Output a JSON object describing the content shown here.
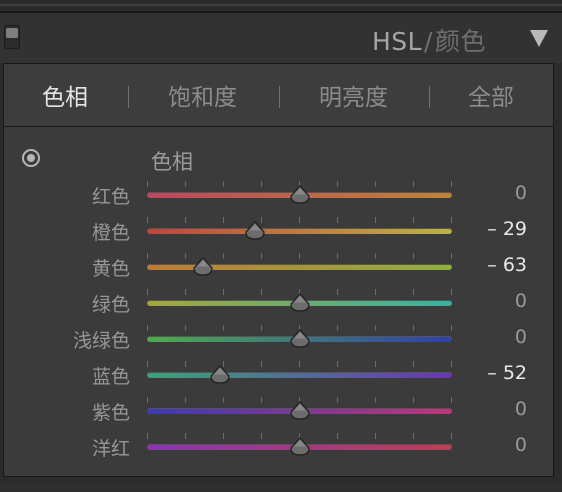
{
  "header": {
    "title_hsl": "HSL",
    "title_sep": "/",
    "title_color": "颜色",
    "collapse_icon": "triangle-down-icon"
  },
  "tabs": [
    {
      "label": "色相",
      "active": true
    },
    {
      "label": "饱和度",
      "active": false
    },
    {
      "label": "明亮度",
      "active": false
    },
    {
      "label": "全部",
      "active": false
    }
  ],
  "section": {
    "title": "色相",
    "tat_icon": "target-adjust-icon"
  },
  "slider_range": [
    -100,
    100
  ],
  "rows": [
    {
      "id": "red",
      "label": "红色",
      "value": "0",
      "numeric": 0,
      "gradient": [
        "#c0455e",
        "#c08434"
      ]
    },
    {
      "id": "orange",
      "label": "橙色",
      "value": "– 29",
      "numeric": -29,
      "gradient": [
        "#c0453c",
        "#bdb344"
      ]
    },
    {
      "id": "yellow",
      "label": "黄色",
      "value": "– 63",
      "numeric": -63,
      "gradient": [
        "#c07a33",
        "#8fb23c"
      ]
    },
    {
      "id": "green",
      "label": "绿色",
      "value": "0",
      "numeric": 0,
      "gradient": [
        "#a5a63a",
        "#35b3a2"
      ]
    },
    {
      "id": "aqua",
      "label": "浅绿色",
      "value": "0",
      "numeric": 0,
      "gradient": [
        "#4cae4a",
        "#2f3fb0"
      ]
    },
    {
      "id": "blue",
      "label": "蓝色",
      "value": "– 52",
      "numeric": -52,
      "gradient": [
        "#3aa478",
        "#6a35b6"
      ]
    },
    {
      "id": "purple",
      "label": "紫色",
      "value": "0",
      "numeric": 0,
      "gradient": [
        "#3b3ab5",
        "#c0357a"
      ]
    },
    {
      "id": "magenta",
      "label": "洋红",
      "value": "0",
      "numeric": 0,
      "gradient": [
        "#8a35b5",
        "#c03c52"
      ]
    }
  ]
}
